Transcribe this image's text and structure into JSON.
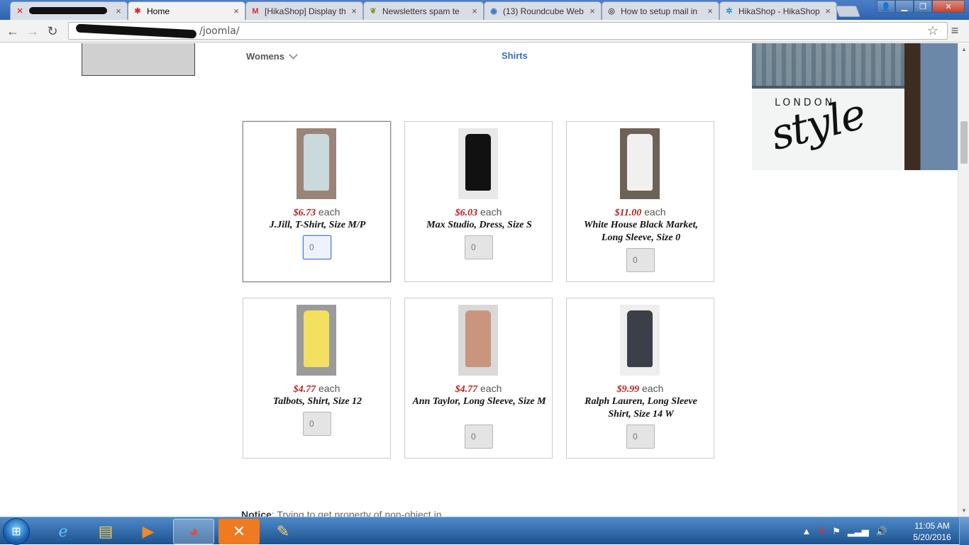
{
  "browser": {
    "tabs": [
      {
        "label": "",
        "favicon": "x",
        "redacted": true
      },
      {
        "label": "Home",
        "favicon": "joomla",
        "active": true
      },
      {
        "label": "[HikaShop] Display th",
        "favicon": "M"
      },
      {
        "label": "Newsletters spam te",
        "favicon": "leaf"
      },
      {
        "label": "(13) Roundcube Web",
        "favicon": "rc"
      },
      {
        "label": "How to setup mail in",
        "favicon": "e"
      },
      {
        "label": "HikaShop - HikaShop",
        "favicon": "hika"
      }
    ],
    "address": "/joomla/",
    "close_glyph": "×"
  },
  "page": {
    "nav": {
      "womens": "Womens",
      "shirts": "Shirts"
    },
    "banner": {
      "line1": "LONDON",
      "line2": "style"
    },
    "products": [
      {
        "price": "$6.73",
        "each": "each",
        "name": "J.Jill, T-Shirt, Size M/P",
        "qty": "0",
        "swatch": "#c9d9dc",
        "bg": "#9a8377"
      },
      {
        "price": "$6.03",
        "each": "each",
        "name": "Max Studio, Dress, Size S",
        "qty": "0",
        "swatch": "#111111",
        "bg": "#e8e8e8"
      },
      {
        "price": "$11.00",
        "each": "each",
        "name": "White House Black Market, Long Sleeve, Size 0",
        "qty": "0",
        "swatch": "#f2f0ee",
        "bg": "#6d6258"
      },
      {
        "price": "$4.77",
        "each": "each",
        "name": "Talbots, Shirt, Size 12",
        "qty": "0",
        "swatch": "#f3e060",
        "bg": "#9b9b9b"
      },
      {
        "price": "$4.77",
        "each": "each",
        "name": "Ann Taylor, Long Sleeve, Size M",
        "qty": "0",
        "swatch": "#c9957d",
        "bg": "#d9d9d9"
      },
      {
        "price": "$9.99",
        "each": "each",
        "name": "Ralph Lauren, Long Sleeve Shirt, Size 14 W",
        "qty": "0",
        "swatch": "#3a3f48",
        "bg": "#eeeeee"
      }
    ],
    "notice": {
      "label": "Notice",
      "text": ": Trying to get property of non-object in"
    }
  },
  "taskbar": {
    "clock_time": "11:05 AM",
    "clock_date": "5/20/2016"
  },
  "colors": {
    "price": "#c01b1b",
    "link": "#3a6dc0"
  }
}
